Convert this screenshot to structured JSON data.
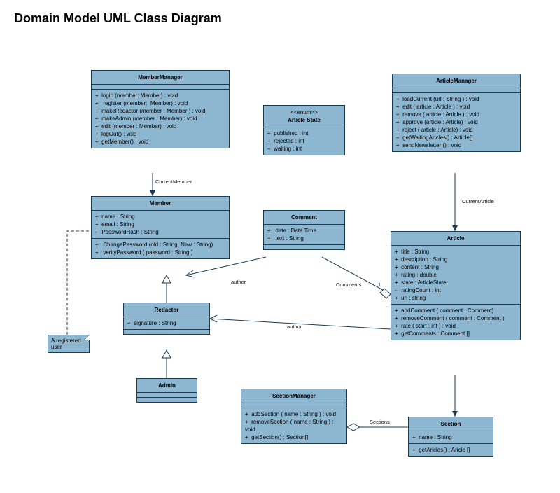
{
  "title": "Domain Model UML Class Diagram",
  "note": "A registered user",
  "labels": {
    "currentMember": "CurrentMember",
    "currentArticle": "CurrentArticle",
    "author1": "author",
    "author2": "author",
    "comments": "Comments",
    "one": "1",
    "sections": "Sections"
  },
  "classes": {
    "memberManager": {
      "name": "MemberManager",
      "ops": "+  login (member: Member) : void\n+   register (member:  Member) : void\n+  makeRedactor (member : Member ) : void\n+  makeAdmin (member : Member) : void\n+  edit (member : Member) : void\n+  logOut() : void\n+  getMember() : void"
    },
    "articleManager": {
      "name": "ArticleManager",
      "ops": "+  loadCurrent (url : String ) : void\n+  edit ( article : Article ) : void\n+  remove ( article : Article ) : void\n+  approve (article : Article) : void\n+  reject ( article : Article) : void\n+  getWaitingArtcles() : Article[]\n+  sendNewsletter () : void"
    },
    "articleState": {
      "stereo": "<<enum>>",
      "name": "Article State",
      "attrs": "+  published : int\n+  rejected : int\n+  waiting : int"
    },
    "member": {
      "name": "Member",
      "attrs": "+  name : String\n+  email : String\n-   PasswordHash : String",
      "ops": "+   ChangePassword (old : String, New : String)\n+   verityPassword ( password : String )"
    },
    "comment": {
      "name": "Comment",
      "attrs": "+   date : Date Time\n+   text : String"
    },
    "article": {
      "name": "Article",
      "attrs": "+  title : String\n+  description : String\n+  content : String\n+  rating : double\n+  state : ArticleState\n-   ratingCount : int\n+  url : string",
      "ops": "+  addComment ( comment : Comment)\n+  removeComment ( comment : Comment )\n+  rate ( start : inf ) : void\n+  getComments : Comment []"
    },
    "redactor": {
      "name": "Redactor",
      "attrs": "+  signature : String"
    },
    "admin": {
      "name": "Admin"
    },
    "sectionManager": {
      "name": "SectionManager",
      "ops": "+  addSection ( name : String ) : void\n+  removeSection ( name : String ) : void\n+  getSection() : Section[]"
    },
    "section": {
      "name": "Section",
      "attrs": "+  name : String",
      "ops": "+  getAricles() : Aricle []"
    }
  }
}
